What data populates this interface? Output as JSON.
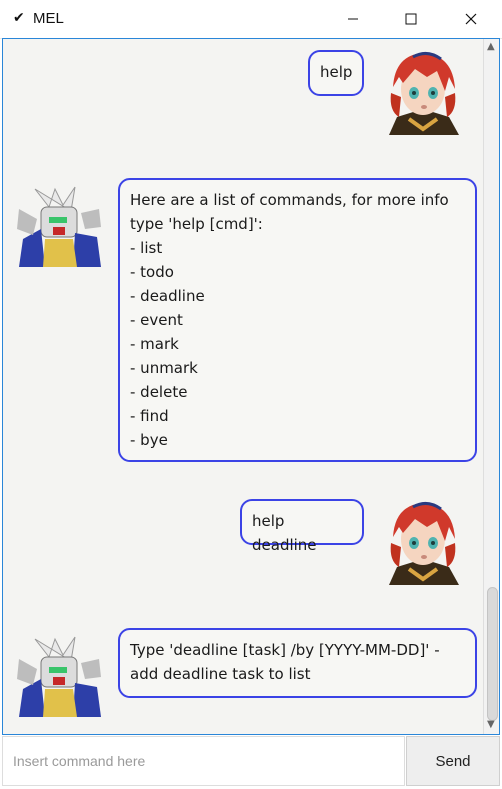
{
  "window": {
    "title": "MEL",
    "app_icon": "check-icon"
  },
  "messages": [
    {
      "sender": "user",
      "avatar": "user-avatar",
      "text": "help"
    },
    {
      "sender": "bot",
      "avatar": "bot-avatar",
      "text": "Here are a list of commands, for more info\ntype 'help [cmd]':\n- list\n- todo\n- deadline\n- event\n- mark\n- unmark\n- delete\n- find\n- bye"
    },
    {
      "sender": "user",
      "avatar": "user-avatar",
      "text": "help deadline"
    },
    {
      "sender": "bot",
      "avatar": "bot-avatar",
      "text": "Type 'deadline [task] /by [YYYY-MM-DD]' -\nadd deadline task to list"
    }
  ],
  "input": {
    "placeholder": "Insert command here",
    "value": ""
  },
  "send_label": "Send",
  "colors": {
    "bubble_border": "#3b43e6",
    "chat_background": "#f4f4f2"
  }
}
